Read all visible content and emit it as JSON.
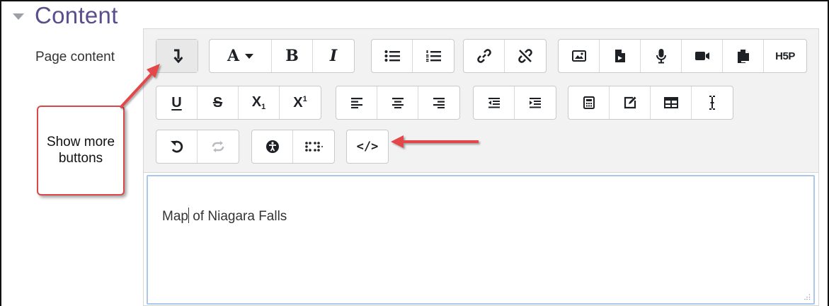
{
  "section": {
    "title": "Content",
    "caret_icon": "caret-down-icon"
  },
  "field": {
    "label": "Page content"
  },
  "toolbar": {
    "row1": [
      {
        "name": "show-more-buttons-button",
        "icon": "arrow-down-icon"
      },
      {
        "name": "font-style-button",
        "label": "A"
      },
      {
        "name": "bold-button",
        "label": "B"
      },
      {
        "name": "italic-button",
        "label": "I"
      },
      {
        "name": "unordered-list-button",
        "icon": "list-ul-icon"
      },
      {
        "name": "ordered-list-button",
        "icon": "list-ol-icon"
      },
      {
        "name": "link-button",
        "icon": "link-icon"
      },
      {
        "name": "unlink-button",
        "icon": "unlink-icon"
      },
      {
        "name": "image-button",
        "icon": "image-icon"
      },
      {
        "name": "media-button",
        "icon": "file-icon"
      },
      {
        "name": "record-audio-button",
        "icon": "microphone-icon"
      },
      {
        "name": "record-video-button",
        "icon": "video-camera-icon"
      },
      {
        "name": "manage-files-button",
        "icon": "copy-icon"
      },
      {
        "name": "h5p-button",
        "label": "H5P"
      }
    ],
    "row2_labels": {
      "underline": "U",
      "strike": "S",
      "subscript": "X",
      "subscript_mark": "1",
      "superscript": "X",
      "superscript_mark": "1"
    },
    "row2_icons": [
      "align-left-icon",
      "align-center-icon",
      "align-right-icon",
      "outdent-icon",
      "indent-icon",
      "calculator-icon",
      "edit-icon",
      "table-icon",
      "text-cursor-icon"
    ],
    "row3": {
      "html_label": "</>"
    },
    "row3_icons": [
      "undo-icon",
      "redo-icon",
      "accessibility-icon",
      "braille-icon"
    ]
  },
  "editor": {
    "text_before_caret": "Map",
    "text_after_caret": " of Niagara Falls"
  },
  "annotation": {
    "callout_text": "Show more buttons",
    "color": "#d9474a"
  },
  "colors": {
    "section_title": "#5a4e8c",
    "focus_border": "#a9c8ea",
    "toolbar_bg": "#f2f2f2"
  }
}
